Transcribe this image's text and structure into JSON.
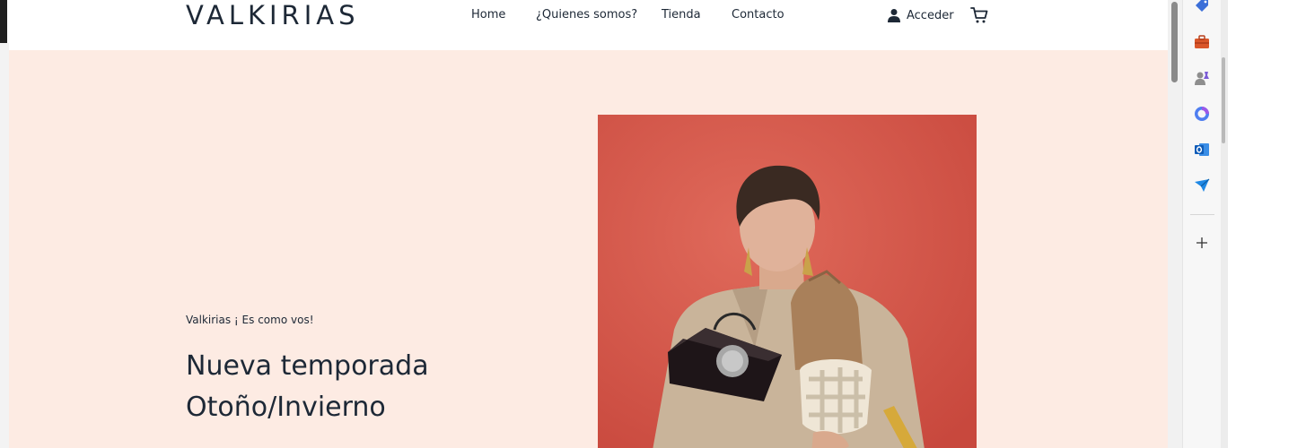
{
  "site": {
    "logo": "VALKIRIAS",
    "nav": {
      "home": "Home",
      "about": "¿Quienes somos?",
      "store": "Tienda",
      "contact": "Contacto"
    },
    "login_label": "Acceder",
    "cart_icon": "cart-icon",
    "user_icon": "user-icon"
  },
  "hero": {
    "tagline": "Valkirias ¡ Es como vos!",
    "headline_line1": "Nueva temporada",
    "headline_line2": "Otoño/Invierno",
    "background_color": "#fdebe3",
    "image_background": "#d4574a"
  },
  "browser_sidebar": {
    "icons": [
      "tag-icon",
      "toolbox-icon",
      "games-icon",
      "copilot-icon",
      "outlook-icon",
      "send-icon",
      "add-icon"
    ]
  }
}
